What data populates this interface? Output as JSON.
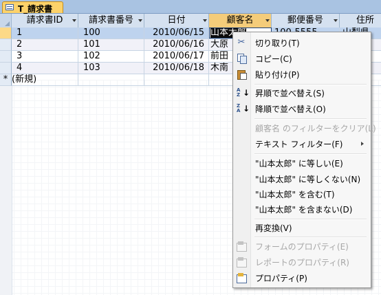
{
  "tab": {
    "label": "T_請求書",
    "icon": "table-icon"
  },
  "columns": [
    "請求書ID",
    "請求書番号",
    "日付",
    "顧客名",
    "郵便番号",
    "住所"
  ],
  "rows": [
    {
      "id": "1",
      "number": "100",
      "date": "2010/06/15",
      "customer": "山本太郎",
      "zip": "100-5555",
      "address": "山梨県"
    },
    {
      "id": "2",
      "number": "101",
      "date": "2010/06/16",
      "customer": "大原",
      "zip": "",
      "address": "長"
    },
    {
      "id": "3",
      "number": "102",
      "date": "2010/06/17",
      "customer": "前田",
      "zip": "",
      "address": "静"
    },
    {
      "id": "4",
      "number": "103",
      "date": "2010/06/18",
      "customer": "木南",
      "zip": "",
      "address": "千"
    }
  ],
  "new_row": {
    "marker": "*",
    "label": "(新規)"
  },
  "context_menu": {
    "items": [
      {
        "label": "切り取り(T)",
        "icon": "scissors-icon",
        "enabled": true
      },
      {
        "label": "コピー(C)",
        "icon": "copy-icon",
        "enabled": true
      },
      {
        "label": "貼り付け(P)",
        "icon": "paste-icon",
        "enabled": true
      },
      {
        "label": "昇順で並べ替え(S)",
        "icon": "sort-ascending-icon",
        "enabled": true
      },
      {
        "label": "降順で並べ替え(O)",
        "icon": "sort-descending-icon",
        "enabled": true
      },
      {
        "label": "顧客名 のフィルターをクリア(L)",
        "icon": "",
        "enabled": false
      },
      {
        "label": "テキスト フィルター(F)",
        "icon": "",
        "enabled": true,
        "submenu": true
      },
      {
        "label": "\"山本太郎\" に等しい(E)",
        "icon": "",
        "enabled": true
      },
      {
        "label": "\"山本太郎\" に等しくない(N)",
        "icon": "",
        "enabled": true
      },
      {
        "label": "\"山本太郎\" を含む(T)",
        "icon": "",
        "enabled": true
      },
      {
        "label": "\"山本太郎\" を含まない(D)",
        "icon": "",
        "enabled": true
      },
      {
        "label": "再変換(V)",
        "icon": "",
        "enabled": true
      },
      {
        "label": "フォームのプロパティ(E)",
        "icon": "form-properties-icon",
        "enabled": false
      },
      {
        "label": "レポートのプロパティ(R)",
        "icon": "report-properties-icon",
        "enabled": false
      },
      {
        "label": "プロパティ(P)",
        "icon": "properties-icon",
        "enabled": true
      }
    ]
  },
  "colors": {
    "tab": "#fdd26a",
    "header": "#d5e1f0",
    "selected_row": "#bed3ee",
    "selected_header": "#f4cc7a"
  }
}
